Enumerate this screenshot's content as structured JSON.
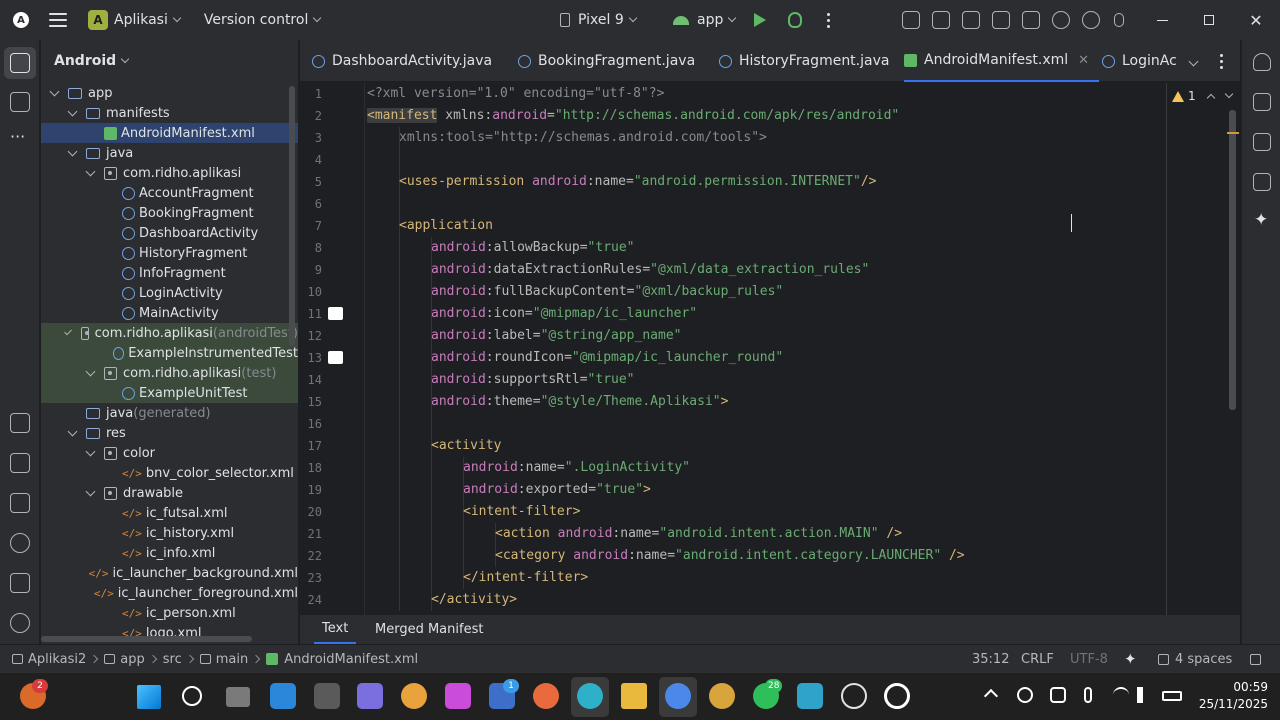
{
  "titlebar": {
    "project_badge": "A",
    "project_name": "Aplikasi",
    "version_control": "Version control",
    "device": "Pixel 9",
    "run_config": "app"
  },
  "project_panel": {
    "view": "Android",
    "tree": [
      {
        "label": "app",
        "suffix": "",
        "icon": "folder-icon",
        "arrow": true,
        "depth": 0
      },
      {
        "label": "manifests",
        "suffix": "",
        "icon": "folder-icon",
        "arrow": true,
        "depth": 1
      },
      {
        "label": "AndroidManifest.xml",
        "suffix": "",
        "icon": "manifest-icon",
        "arrow": false,
        "depth": 2,
        "selected": true
      },
      {
        "label": "java",
        "suffix": "",
        "icon": "folder-icon",
        "arrow": true,
        "depth": 1
      },
      {
        "label": "com.ridho.aplikasi",
        "suffix": "",
        "icon": "package-icon",
        "arrow": true,
        "depth": 2
      },
      {
        "label": "AccountFragment",
        "suffix": "",
        "icon": "class-icon",
        "arrow": false,
        "depth": 3
      },
      {
        "label": "BookingFragment",
        "suffix": "",
        "icon": "class-icon",
        "arrow": false,
        "depth": 3
      },
      {
        "label": "DashboardActivity",
        "suffix": "",
        "icon": "class-icon",
        "arrow": false,
        "depth": 3
      },
      {
        "label": "HistoryFragment",
        "suffix": "",
        "icon": "class-icon",
        "arrow": false,
        "depth": 3
      },
      {
        "label": "InfoFragment",
        "suffix": "",
        "icon": "class-icon",
        "arrow": false,
        "depth": 3
      },
      {
        "label": "LoginActivity",
        "suffix": "",
        "icon": "class-icon",
        "arrow": false,
        "depth": 3
      },
      {
        "label": "MainActivity",
        "suffix": "",
        "icon": "class-icon",
        "arrow": false,
        "depth": 3
      },
      {
        "label": "com.ridho.aplikasi",
        "suffix": " (androidTest)",
        "icon": "package-icon",
        "arrow": true,
        "depth": 2,
        "tint": true
      },
      {
        "label": "ExampleInstrumentedTest",
        "suffix": "",
        "icon": "class-icon",
        "arrow": false,
        "depth": 3,
        "tint": true
      },
      {
        "label": "com.ridho.aplikasi",
        "suffix": " (test)",
        "icon": "package-icon",
        "arrow": true,
        "depth": 2,
        "tint": true
      },
      {
        "label": "ExampleUnitTest",
        "suffix": "",
        "icon": "class-icon",
        "arrow": false,
        "depth": 3,
        "tint": true
      },
      {
        "label": "java",
        "suffix": " (generated)",
        "icon": "folder-icon",
        "arrow": false,
        "depth": 1
      },
      {
        "label": "res",
        "suffix": "",
        "icon": "folder-icon",
        "arrow": true,
        "depth": 1
      },
      {
        "label": "color",
        "suffix": "",
        "icon": "package-icon",
        "arrow": true,
        "depth": 2
      },
      {
        "label": "bnv_color_selector.xml",
        "suffix": "",
        "icon": "xml-icon",
        "arrow": false,
        "depth": 3
      },
      {
        "label": "drawable",
        "suffix": "",
        "icon": "package-icon",
        "arrow": true,
        "depth": 2
      },
      {
        "label": "ic_futsal.xml",
        "suffix": "",
        "icon": "xml-icon",
        "arrow": false,
        "depth": 3
      },
      {
        "label": "ic_history.xml",
        "suffix": "",
        "icon": "xml-icon",
        "arrow": false,
        "depth": 3
      },
      {
        "label": "ic_info.xml",
        "suffix": "",
        "icon": "xml-icon",
        "arrow": false,
        "depth": 3
      },
      {
        "label": "ic_launcher_background.xml",
        "suffix": "",
        "icon": "xml-icon",
        "arrow": false,
        "depth": 3
      },
      {
        "label": "ic_launcher_foreground.xml",
        "suffix": "",
        "icon": "xml-icon",
        "arrow": false,
        "depth": 3
      },
      {
        "label": "ic_person.xml",
        "suffix": "",
        "icon": "xml-icon",
        "arrow": false,
        "depth": 3
      },
      {
        "label": "logo.xml",
        "suffix": "",
        "icon": "xml-icon",
        "arrow": false,
        "depth": 3
      }
    ]
  },
  "tabs": [
    {
      "label": "DashboardActivity.java",
      "icon": "class-icon",
      "active": false
    },
    {
      "label": "BookingFragment.java",
      "icon": "class-icon",
      "active": false
    },
    {
      "label": "HistoryFragment.java",
      "icon": "class-icon",
      "active": false
    },
    {
      "label": "AndroidManifest.xml",
      "icon": "manifest-icon",
      "active": true
    },
    {
      "label": "LoginAc",
      "icon": "class-icon",
      "active": false
    }
  ],
  "editor": {
    "warning_count": "1",
    "lines": [
      {
        "n": "1",
        "indent": 0,
        "parts": [
          [
            "dim",
            "<?xml version=\"1.0\" encoding=\"utf-8\"?>"
          ]
        ]
      },
      {
        "n": "2",
        "indent": 0,
        "parts": [
          [
            "hltag",
            "<manifest"
          ],
          [
            "attr",
            " xmlns:"
          ],
          [
            "ns",
            "android"
          ],
          [
            "attr",
            "="
          ],
          [
            "str",
            "\"http://schemas.android.com/apk/res/android\""
          ]
        ]
      },
      {
        "n": "3",
        "indent": 1,
        "parts": [
          [
            "dim",
            "xmlns:tools=\"http://schemas.android.com/tools\">"
          ]
        ]
      },
      {
        "n": "4",
        "indent": 0,
        "parts": []
      },
      {
        "n": "5",
        "indent": 1,
        "parts": [
          [
            "tag",
            "<uses-permission "
          ],
          [
            "ns",
            "android"
          ],
          [
            "attr",
            ":name="
          ],
          [
            "str",
            "\"android.permission.INTERNET\""
          ],
          [
            "tag",
            "/>"
          ]
        ]
      },
      {
        "n": "6",
        "indent": 0,
        "parts": []
      },
      {
        "n": "7",
        "indent": 1,
        "parts": [
          [
            "tag",
            "<application"
          ]
        ]
      },
      {
        "n": "8",
        "indent": 2,
        "parts": [
          [
            "ns",
            "android"
          ],
          [
            "attr",
            ":allowBackup="
          ],
          [
            "str",
            "\"true\""
          ]
        ]
      },
      {
        "n": "9",
        "indent": 2,
        "parts": [
          [
            "ns",
            "android"
          ],
          [
            "attr",
            ":dataExtractionRules="
          ],
          [
            "str",
            "\"@xml/data_extraction_rules\""
          ]
        ]
      },
      {
        "n": "10",
        "indent": 2,
        "parts": [
          [
            "ns",
            "android"
          ],
          [
            "attr",
            ":fullBackupContent="
          ],
          [
            "str",
            "\"@xml/backup_rules\""
          ]
        ]
      },
      {
        "n": "11",
        "indent": 2,
        "parts": [
          [
            "ns",
            "android"
          ],
          [
            "attr",
            ":icon="
          ],
          [
            "str",
            "\"@mipmap/ic_launcher\""
          ]
        ],
        "gutter_icon": true
      },
      {
        "n": "12",
        "indent": 2,
        "parts": [
          [
            "ns",
            "android"
          ],
          [
            "attr",
            ":label="
          ],
          [
            "str",
            "\"@string/app_name\""
          ]
        ]
      },
      {
        "n": "13",
        "indent": 2,
        "parts": [
          [
            "ns",
            "android"
          ],
          [
            "attr",
            ":roundIcon="
          ],
          [
            "str",
            "\"@mipmap/ic_launcher_round\""
          ]
        ],
        "gutter_icon": true
      },
      {
        "n": "14",
        "indent": 2,
        "parts": [
          [
            "ns",
            "android"
          ],
          [
            "attr",
            ":supportsRtl="
          ],
          [
            "str",
            "\"true\""
          ]
        ]
      },
      {
        "n": "15",
        "indent": 2,
        "parts": [
          [
            "ns",
            "android"
          ],
          [
            "attr",
            ":theme="
          ],
          [
            "str",
            "\"@style/Theme.Aplikasi\""
          ],
          [
            "tag",
            ">"
          ]
        ]
      },
      {
        "n": "16",
        "indent": 0,
        "parts": []
      },
      {
        "n": "17",
        "indent": 2,
        "parts": [
          [
            "tag",
            "<activity"
          ]
        ]
      },
      {
        "n": "18",
        "indent": 3,
        "parts": [
          [
            "ns",
            "android"
          ],
          [
            "attr",
            ":name="
          ],
          [
            "str",
            "\".LoginActivity\""
          ]
        ]
      },
      {
        "n": "19",
        "indent": 3,
        "parts": [
          [
            "ns",
            "android"
          ],
          [
            "attr",
            ":exported="
          ],
          [
            "str",
            "\"true\""
          ],
          [
            "tag",
            ">"
          ]
        ]
      },
      {
        "n": "20",
        "indent": 3,
        "parts": [
          [
            "tag",
            "<intent-filter>"
          ]
        ]
      },
      {
        "n": "21",
        "indent": 4,
        "parts": [
          [
            "tag",
            "<action "
          ],
          [
            "ns",
            "android"
          ],
          [
            "attr",
            ":name="
          ],
          [
            "str",
            "\"android.intent.action.MAIN\""
          ],
          [
            "tag",
            " />"
          ]
        ]
      },
      {
        "n": "22",
        "indent": 4,
        "parts": [
          [
            "tag",
            "<category "
          ],
          [
            "ns",
            "android"
          ],
          [
            "attr",
            ":name="
          ],
          [
            "str",
            "\"android.intent.category.LAUNCHER\""
          ],
          [
            "tag",
            " />"
          ]
        ]
      },
      {
        "n": "23",
        "indent": 3,
        "parts": [
          [
            "tag",
            "</intent-filter>"
          ]
        ]
      },
      {
        "n": "24",
        "indent": 2,
        "parts": [
          [
            "tag",
            "</activity>"
          ]
        ]
      }
    ]
  },
  "editor_bottom_tabs": {
    "text": "Text",
    "merged": "Merged Manifest"
  },
  "statusbar": {
    "breadcrumb": [
      "Aplikasi2",
      "app",
      "src",
      "main",
      "AndroidManifest.xml"
    ],
    "position": "35:12",
    "line_sep": "CRLF",
    "encoding": "UTF-8",
    "indent": "4 spaces"
  },
  "taskbar": {
    "badge_widget": "2",
    "badge_store": "1",
    "badge_whatsapp": "28",
    "time": "00:59",
    "date": "25/11/2025"
  },
  "colors": {
    "accent": "#3574f0",
    "selection": "#2e436e",
    "string": "#6aab73",
    "tag": "#d5b778",
    "namespace": "#c77dbb"
  }
}
